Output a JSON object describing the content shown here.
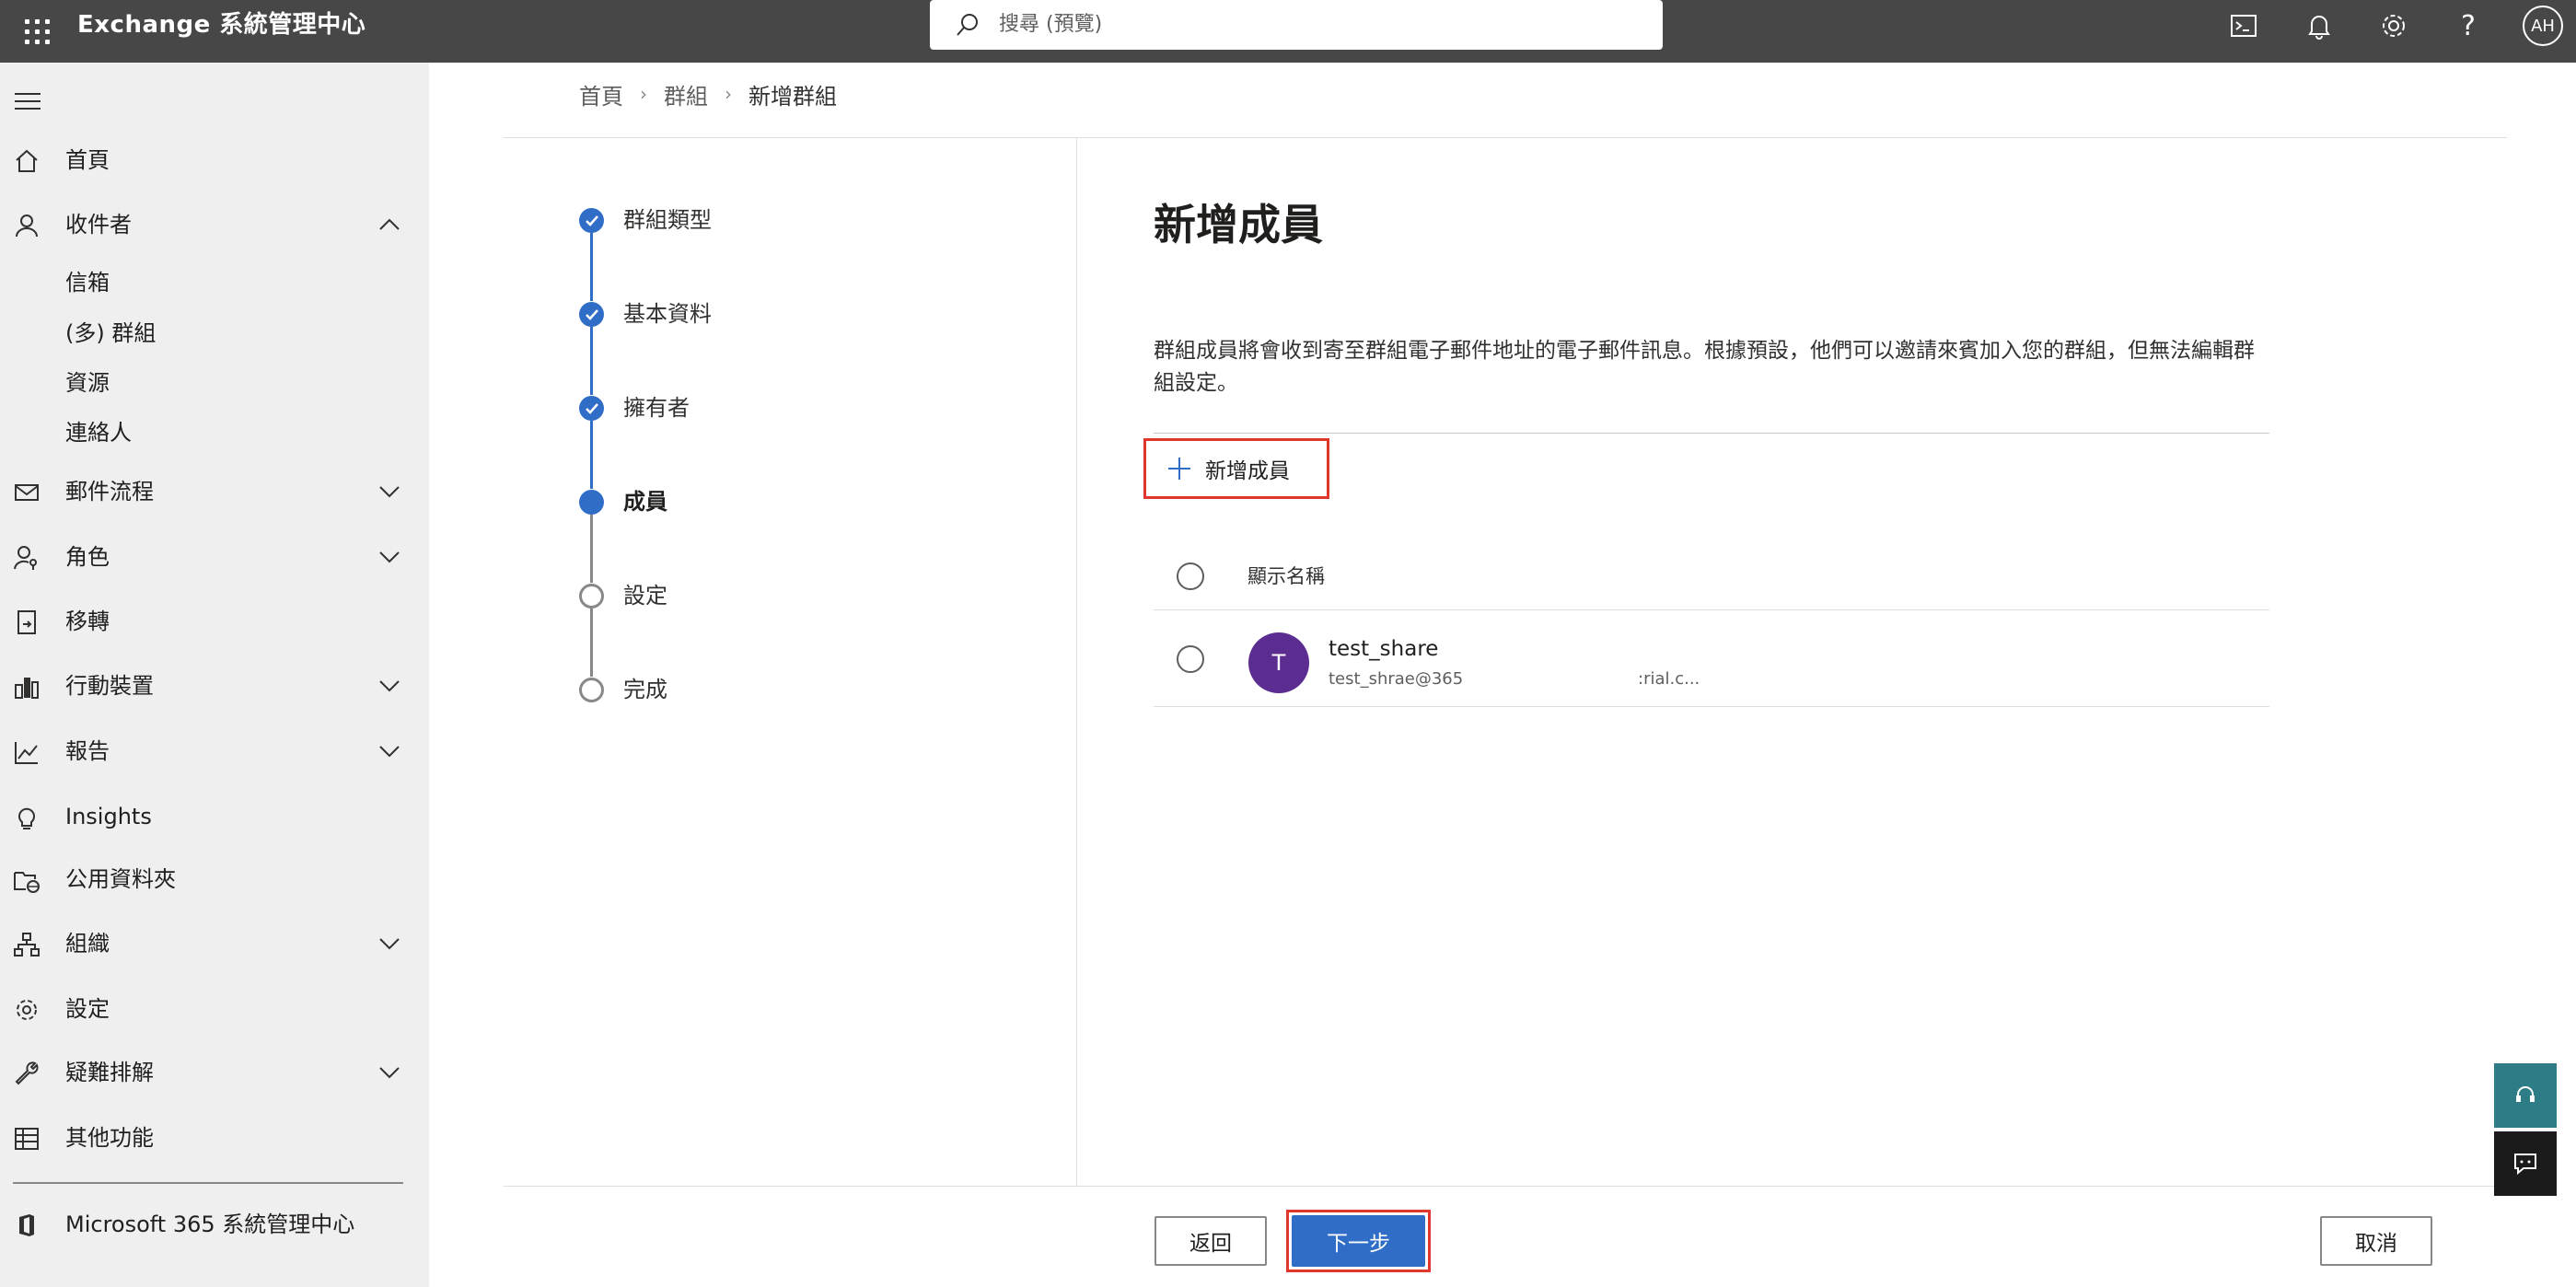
{
  "app": {
    "title": "Exchange 系統管理中心"
  },
  "search": {
    "placeholder": "搜尋 (預覽)"
  },
  "user": {
    "initials": "AH"
  },
  "topbar_icons": [
    "terminal-icon",
    "bell-icon",
    "gear-icon",
    "help-icon"
  ],
  "sidebar": {
    "items": [
      {
        "label": "首頁",
        "icon": "home-icon"
      },
      {
        "label": "收件者",
        "icon": "person-icon",
        "expanded": true
      },
      {
        "label": "郵件流程",
        "icon": "mail-icon"
      },
      {
        "label": "角色",
        "icon": "person-key-icon"
      },
      {
        "label": "移轉",
        "icon": "migration-icon"
      },
      {
        "label": "行動裝置",
        "icon": "mobile-icon"
      },
      {
        "label": "報告",
        "icon": "chart-icon"
      },
      {
        "label": "Insights",
        "icon": "lightbulb-icon"
      },
      {
        "label": "公用資料夾",
        "icon": "folder-globe-icon"
      },
      {
        "label": "組織",
        "icon": "org-icon"
      },
      {
        "label": "設定",
        "icon": "gear-icon"
      },
      {
        "label": "疑難排解",
        "icon": "wrench-icon"
      },
      {
        "label": "其他功能",
        "icon": "table-icon"
      }
    ],
    "sub_items": [
      "信箱",
      "(多) 群組",
      "資源",
      "連絡人"
    ],
    "footer": {
      "label": "Microsoft 365 系統管理中心",
      "icon": "office-icon"
    }
  },
  "breadcrumb": [
    "首頁",
    "群組",
    "新增群組"
  ],
  "steps": [
    {
      "label": "群組類型",
      "status": "done"
    },
    {
      "label": "基本資料",
      "status": "done"
    },
    {
      "label": "擁有者",
      "status": "done"
    },
    {
      "label": "成員",
      "status": "current"
    },
    {
      "label": "設定",
      "status": "todo"
    },
    {
      "label": "完成",
      "status": "todo"
    }
  ],
  "main": {
    "title": "新增成員",
    "description": "群組成員將會收到寄至群組電子郵件地址的電子郵件訊息。根據預設，他們可以邀請來賓加入您的群組，但無法編輯群組設定。",
    "add_member_label": "新增成員",
    "column_header": "顯示名稱",
    "members": [
      {
        "initial": "T",
        "name": "test_share",
        "email": "test_shrae@365",
        "email_tail": ":rial.c..."
      }
    ]
  },
  "footer": {
    "back_label": "返回",
    "next_label": "下一步",
    "cancel_label": "取消"
  },
  "colors": {
    "topbar": "#474747",
    "accent": "#2f6dc7",
    "highlight": "#e0362b",
    "avatar": "#5c2d91",
    "support": "#2e7d86"
  }
}
